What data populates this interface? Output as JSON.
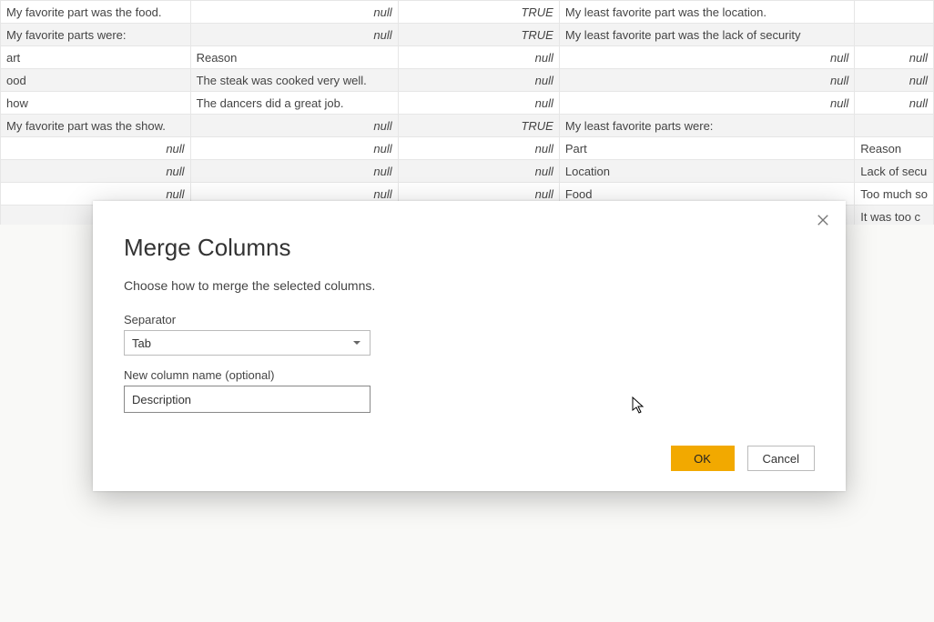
{
  "table": {
    "rows": [
      {
        "c1": "My favorite part was the food.",
        "c1null": false,
        "c2": "null",
        "c2null": true,
        "c3": "TRUE",
        "c3true": true,
        "c4": "My least favorite part was the location.",
        "c4null": false,
        "c5": "",
        "c5null": false
      },
      {
        "c1": "My favorite parts were:",
        "c1null": false,
        "c2": "null",
        "c2null": true,
        "c3": "TRUE",
        "c3true": true,
        "c4": "My least favorite part was  the lack of security",
        "c4null": false,
        "c5": "",
        "c5null": false
      },
      {
        "c1": "art",
        "c1null": false,
        "c2": "Reason",
        "c2null": false,
        "c3": "null",
        "c3null": true,
        "c4": "null",
        "c4null": true,
        "c5": "null",
        "c5null": true
      },
      {
        "c1": "ood",
        "c1null": false,
        "c2": "The steak was cooked very well.",
        "c2null": false,
        "c3": "null",
        "c3null": true,
        "c4": "null",
        "c4null": true,
        "c5": "null",
        "c5null": true
      },
      {
        "c1": "how",
        "c1null": false,
        "c2": "The dancers did a great job.",
        "c2null": false,
        "c3": "null",
        "c3null": true,
        "c4": "null",
        "c4null": true,
        "c5": "null",
        "c5null": true
      },
      {
        "c1": "My favorite part was the show.",
        "c1null": false,
        "c2": "null",
        "c2null": true,
        "c3": "TRUE",
        "c3true": true,
        "c4": "My least favorite parts were:",
        "c4null": false,
        "c5": "",
        "c5null": false
      },
      {
        "c1": "null",
        "c1null": true,
        "c2": "null",
        "c2null": true,
        "c3": "null",
        "c3null": true,
        "c4": "Part",
        "c4null": false,
        "c5": "Reason",
        "c5null": false
      },
      {
        "c1": "null",
        "c1null": true,
        "c2": "null",
        "c2null": true,
        "c3": "null",
        "c3null": true,
        "c4": "Location",
        "c4null": false,
        "c5": "Lack of secu",
        "c5null": false
      },
      {
        "c1": "null",
        "c1null": true,
        "c2": "null",
        "c2null": true,
        "c3": "null",
        "c3null": true,
        "c4": "Food",
        "c4null": false,
        "c5": "Too much so",
        "c5null": false
      },
      {
        "c1": "",
        "c1null": false,
        "c2": "",
        "c2null": false,
        "c3": "",
        "c3null": false,
        "c4": "",
        "c4null": false,
        "c5": "It was too c",
        "c5null": false
      }
    ]
  },
  "dialog": {
    "title": "Merge Columns",
    "subtitle": "Choose how to merge the selected columns.",
    "separator_label": "Separator",
    "separator_value": "Tab",
    "newcol_label": "New column name (optional)",
    "newcol_value": "Description",
    "ok_label": "OK",
    "cancel_label": "Cancel"
  }
}
